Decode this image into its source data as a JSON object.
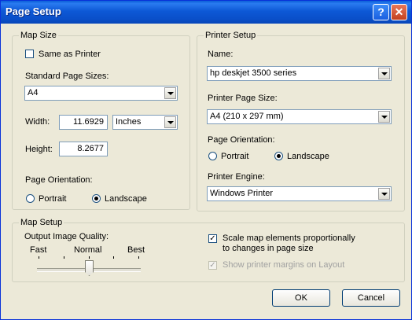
{
  "window": {
    "title": "Page Setup",
    "help_glyph": "?",
    "close_glyph": "✕"
  },
  "map_size": {
    "label": "Map Size",
    "same_as_printer": {
      "label": "Same as Printer",
      "checked": false
    },
    "standard_page_sizes_label": "Standard Page Sizes:",
    "standard_page_size_value": "A4",
    "width_label": "Width:",
    "width_value": "11.6929",
    "units_value": "Inches",
    "height_label": "Height:",
    "height_value": "8.2677",
    "orientation_label": "Page Orientation:",
    "portrait_label": "Portrait",
    "landscape_label": "Landscape",
    "orientation_selected": "Landscape"
  },
  "printer_setup": {
    "label": "Printer Setup",
    "name_label": "Name:",
    "name_value": "hp deskjet 3500 series",
    "page_size_label": "Printer Page Size:",
    "page_size_value": "A4 (210 x 297 mm)",
    "orientation_label": "Page Orientation:",
    "portrait_label": "Portrait",
    "landscape_label": "Landscape",
    "orientation_selected": "Landscape",
    "engine_label": "Printer Engine:",
    "engine_value": "Windows Printer"
  },
  "map_setup": {
    "label": "Map Setup",
    "quality_label": "Output Image Quality:",
    "fast_label": "Fast",
    "normal_label": "Normal",
    "best_label": "Best",
    "quality_level_fraction": 0.5,
    "scale_label_line1": "Scale map elements proportionally",
    "scale_label_line2": "to changes in page size",
    "scale_checked": true,
    "margins_label": "Show printer margins on Layout",
    "margins_checked": true,
    "margins_enabled": false
  },
  "buttons": {
    "ok": "OK",
    "cancel": "Cancel"
  },
  "colors": {
    "title_bar": "#0a4fc9",
    "dialog_bg": "#ece9d8",
    "close_button": "#c4411e"
  }
}
